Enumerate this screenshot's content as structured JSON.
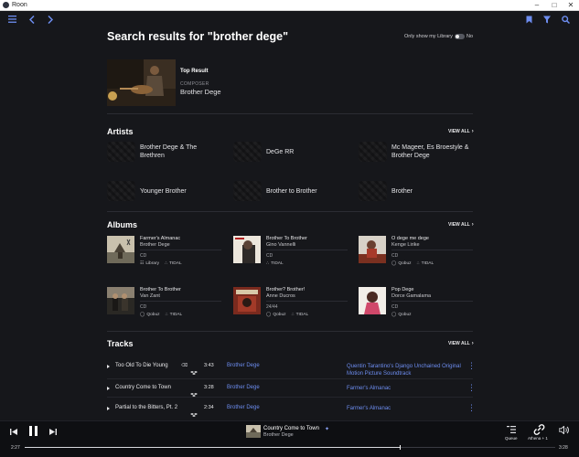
{
  "window": {
    "title": "Roon"
  },
  "search": {
    "heading": "Search results for \"brother dege\"",
    "library_toggle_label": "Only show my Library",
    "library_toggle_state": "No"
  },
  "top_result": {
    "label": "Top Result",
    "kind": "COMPOSER",
    "name": "Brother Dege"
  },
  "artists": {
    "title": "Artists",
    "view_all": "VIEW ALL",
    "items": [
      {
        "name": "Brother Dege & The Brethren"
      },
      {
        "name": "DeGe RR"
      },
      {
        "name": "Mc Mageer, Es Broestyle & Brother Dege"
      },
      {
        "name": "Younger Brother"
      },
      {
        "name": "Brother to Brother"
      },
      {
        "name": "Brother"
      }
    ]
  },
  "albums": {
    "title": "Albums",
    "view_all": "VIEW ALL",
    "items": [
      {
        "title": "Farmer's Almanac",
        "artist": "Brother Dege",
        "format": "CD",
        "sources": [
          "Library",
          "TIDAL"
        ]
      },
      {
        "title": "Brother To Brother",
        "artist": "Gino Vannelli",
        "format": "CD",
        "sources": [
          "TIDAL"
        ]
      },
      {
        "title": "O dege me dege",
        "artist": "Kenge Lirike",
        "format": "CD",
        "sources": [
          "Qobuz",
          "TIDAL"
        ]
      },
      {
        "title": "Brother To Brother",
        "artist": "Van Zant",
        "format": "CD",
        "sources": [
          "Qobuz",
          "TIDAL"
        ]
      },
      {
        "title": "Brother? Brother!",
        "artist": "Anne Ducros",
        "format": "24/44",
        "sources": [
          "Qobuz",
          "TIDAL"
        ]
      },
      {
        "title": "Pop Dege",
        "artist": "Dorce Gamalama",
        "format": "CD",
        "sources": [
          "Qobuz"
        ]
      }
    ]
  },
  "tracks": {
    "title": "Tracks",
    "view_all": "VIEW ALL",
    "items": [
      {
        "title": "Too Old To Die Young",
        "duration": "3:43",
        "artist": "Brother Dege",
        "album": "Quentin Tarantino's Django Unchained Original Motion Picture Soundtrack"
      },
      {
        "title": "Country Come to Town",
        "duration": "3:28",
        "artist": "Brother Dege",
        "album": "Farmer's Almanac"
      },
      {
        "title": "Partial to the Bitters, Pt. 2",
        "duration": "2:34",
        "artist": "Brother Dege",
        "album": "Farmer's Almanac"
      }
    ]
  },
  "player": {
    "now_playing_title": "Country Come to Town",
    "now_playing_artist": "Brother Dege",
    "elapsed": "2:27",
    "total": "3:28",
    "progress_fraction": 0.707,
    "queue_label": "Queue",
    "zone_label": "Athena + 1"
  },
  "colors": {
    "accent": "#6d8df0",
    "background": "#16171b"
  }
}
